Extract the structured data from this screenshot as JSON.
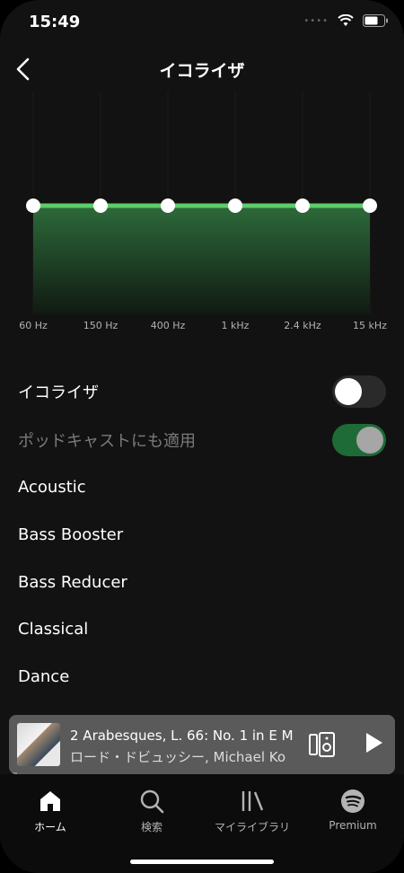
{
  "status_bar": {
    "time": "15:49"
  },
  "header": {
    "title": "イコライザ"
  },
  "equalizer": {
    "bands": [
      {
        "label": "60 Hz",
        "gain": 0
      },
      {
        "label": "150 Hz",
        "gain": 0
      },
      {
        "label": "400 Hz",
        "gain": 0
      },
      {
        "label": "1 kHz",
        "gain": 0
      },
      {
        "label": "2.4 kHz",
        "gain": 0
      },
      {
        "label": "15 kHz",
        "gain": 0
      }
    ],
    "accent_color": "#5dcc6a"
  },
  "settings": {
    "equalizer_toggle": {
      "label": "イコライザ",
      "on": false
    },
    "podcast_toggle": {
      "label": "ポッドキャストにも適用",
      "on": true
    }
  },
  "presets": [
    "Acoustic",
    "Bass Booster",
    "Bass Reducer",
    "Classical",
    "Dance"
  ],
  "mini_player": {
    "title": "2 Arabesques, L. 66: No. 1 in E M",
    "artist": "ロード・ドビュッシー, Michael Ko",
    "progress": 0.02,
    "device_icon": "speaker-device-icon",
    "play_icon": "play-icon"
  },
  "tabbar": {
    "tabs": [
      {
        "label": "ホーム",
        "icon": "home-icon",
        "active": true
      },
      {
        "label": "検索",
        "icon": "search-icon",
        "active": false
      },
      {
        "label": "マイライブラリ",
        "icon": "library-icon",
        "active": false
      },
      {
        "label": "Premium",
        "icon": "spotify-icon",
        "active": false
      }
    ]
  }
}
